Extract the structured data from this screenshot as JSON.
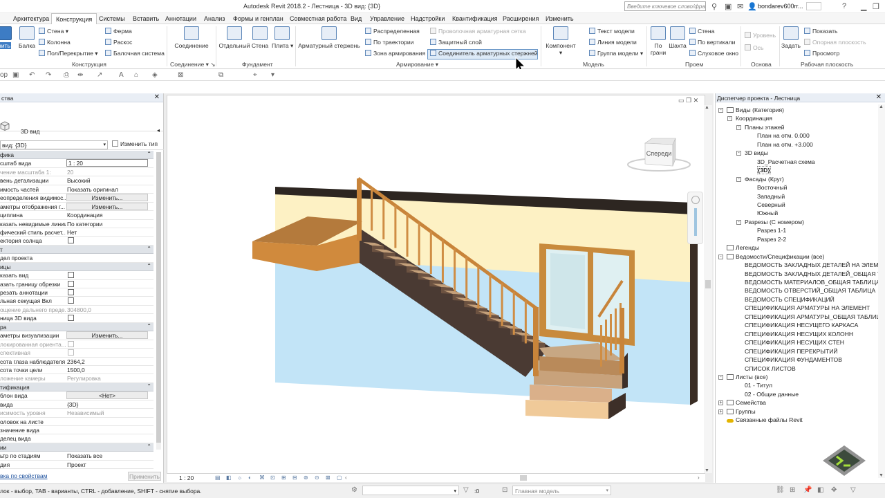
{
  "app": {
    "title": "Autodesk Revit 2018.2 -    Лестница - 3D вид: {3D}"
  },
  "titlebar": {
    "search_placeholder": "Введите ключевое слово/фразу",
    "user": "bondarev600rr..."
  },
  "menu": {
    "tabs": [
      {
        "label": "Архитектура",
        "active": false
      },
      {
        "label": "Конструкция",
        "active": true
      },
      {
        "label": "Системы",
        "active": false
      },
      {
        "label": "Вставить",
        "active": false
      },
      {
        "label": "Аннотации",
        "active": false
      },
      {
        "label": "Анализ",
        "active": false
      },
      {
        "label": "Формы и генплан",
        "active": false
      },
      {
        "label": "Совместная работа",
        "active": false
      },
      {
        "label": "Вид",
        "active": false
      },
      {
        "label": "Управление",
        "active": false
      },
      {
        "label": "Надстройки",
        "active": false
      },
      {
        "label": "Квантификация",
        "active": false
      },
      {
        "label": "Расширения",
        "active": false
      },
      {
        "label": "Изменить",
        "active": false
      }
    ]
  },
  "ribbon": {
    "structure": {
      "label": "Конструкция",
      "balka": "Балка",
      "stena": "Стена",
      "kolonna": "Колонна",
      "pol": "Пол/Перекрытие",
      "ferma": "Ферма",
      "raskos": "Раскос",
      "balochnaya": "Балочная система",
      "izmenit": "нить"
    },
    "connection": {
      "label": "Соединение",
      "btn": "Соединение"
    },
    "foundation": {
      "label": "Фундамент",
      "otdelny": "Отдельный",
      "stena": "Стена",
      "plita": "Плита"
    },
    "reinforcement": {
      "label": "Армирование",
      "armaturny": "Арматурный стержень",
      "raspredelennaya": "Распределенная",
      "po_traektorii": "По траектории",
      "zona": "Зона армирования",
      "provolochnaya": "Проволочная арматурная сетка",
      "zaschitny": "Защитный слой",
      "soedinitel": "Соединитель арматурных стержней"
    },
    "model": {
      "label": "Модель",
      "komponent": "Компонент",
      "tekst": "Текст модели",
      "liniya": "Линия модели",
      "gruppa": "Группа модели"
    },
    "opening": {
      "label": "Проем",
      "po_grani": "По грани",
      "shakhta": "Шахта",
      "stena": "Стена",
      "po_vertikali": "По вертикали",
      "slukhovoe": "Слуховое окно"
    },
    "datum": {
      "label": "Основа",
      "uroven": "Уровень",
      "os": "Ось"
    },
    "workplane": {
      "label": "Рабочая плоскость",
      "zadat": "Задать",
      "pokazat": "Показать",
      "opornaya": "Опорная плоскость",
      "prosmotr": "Просмотр"
    }
  },
  "quick_access": {
    "left_label": "ор"
  },
  "properties": {
    "title": "ства",
    "type_name": "3D вид",
    "selector": "вид: {3D}",
    "edit_type": "Изменить тип",
    "rows": [
      {
        "kind": "sec",
        "name": "фика"
      },
      {
        "kind": "input",
        "name": "сштаб вида",
        "value": "1 : 20"
      },
      {
        "kind": "text",
        "name": "чение масштаба   1:",
        "value": "20",
        "dim": true
      },
      {
        "kind": "text",
        "name": "вень детализации",
        "value": "Высокий"
      },
      {
        "kind": "text",
        "name": "имость частей",
        "value": "Показать оригинал"
      },
      {
        "kind": "btn",
        "name": "еопределения видимос...",
        "value": "Изменить..."
      },
      {
        "kind": "btn",
        "name": "аметры отображения г...",
        "value": "Изменить..."
      },
      {
        "kind": "text",
        "name": "циплина",
        "value": "Координация"
      },
      {
        "kind": "text",
        "name": "казать невидимые линии",
        "value": "По категории"
      },
      {
        "kind": "text",
        "name": "фический стиль расчет...",
        "value": "Нет"
      },
      {
        "kind": "chk",
        "name": "ектория солнца"
      },
      {
        "kind": "sec",
        "name": "т"
      },
      {
        "kind": "text",
        "name": "дел проекта",
        "value": ""
      },
      {
        "kind": "sec",
        "name": "ицы"
      },
      {
        "kind": "chk",
        "name": "казать вид"
      },
      {
        "kind": "chk",
        "name": "азать границу обрезки"
      },
      {
        "kind": "chk",
        "name": "резать аннотации"
      },
      {
        "kind": "chk",
        "name": "льная секущая Вкл"
      },
      {
        "kind": "text",
        "name": "ощение дальнего преде...",
        "value": "304800,0",
        "dim": true
      },
      {
        "kind": "chk",
        "name": "ница 3D вида"
      },
      {
        "kind": "sec",
        "name": "ра"
      },
      {
        "kind": "btn",
        "name": "аметры визуализации",
        "value": "Изменить..."
      },
      {
        "kind": "chkd",
        "name": "локированная ориента..."
      },
      {
        "kind": "chkd",
        "name": "спективная"
      },
      {
        "kind": "text",
        "name": "сота глаза наблюдателя",
        "value": "2364,2"
      },
      {
        "kind": "text",
        "name": "сота точки цели",
        "value": "1500,0"
      },
      {
        "kind": "text",
        "name": "ложение камеры",
        "value": "Регулировка",
        "dim": true
      },
      {
        "kind": "sec",
        "name": "тификация"
      },
      {
        "kind": "btn",
        "name": "блон вида",
        "value": "<Нет>"
      },
      {
        "kind": "text",
        "name": "вида",
        "value": "{3D}"
      },
      {
        "kind": "text",
        "name": "исимость уровня",
        "value": "Независимый",
        "dim": true
      },
      {
        "kind": "text",
        "name": "оловок на листе",
        "value": ""
      },
      {
        "kind": "text",
        "name": "значение вида",
        "value": ""
      },
      {
        "kind": "text",
        "name": "делец вида",
        "value": ""
      },
      {
        "kind": "sec",
        "name": "ии"
      },
      {
        "kind": "text",
        "name": "ьтр по стадиям",
        "value": "Показать все"
      },
      {
        "kind": "text",
        "name": "дия",
        "value": "Проект"
      }
    ],
    "help_link": "вка по свойствам",
    "apply": "Применить"
  },
  "viewport": {
    "scale": "1 : 20",
    "viewcube_label": "Спереди"
  },
  "browser": {
    "title": "Диспетчер проекта - Лестница",
    "items": [
      {
        "label": "Виды (Категория)",
        "level": 0,
        "tog": "-",
        "icon": "views"
      },
      {
        "label": "Координация",
        "level": 1,
        "tog": "-"
      },
      {
        "label": "Планы этажей",
        "level": 2,
        "tog": "-"
      },
      {
        "label": "План на отм. 0.000",
        "level": 3
      },
      {
        "label": "План на отм. +3.000",
        "level": 3
      },
      {
        "label": "3D виды",
        "level": 2,
        "tog": "-"
      },
      {
        "label": "3D_Расчетная схема",
        "level": 3
      },
      {
        "label": "{3D}",
        "level": 3,
        "bold": true
      },
      {
        "label": "Фасады (Круг)",
        "level": 2,
        "tog": "-"
      },
      {
        "label": "Восточный",
        "level": 3
      },
      {
        "label": "Западный",
        "level": 3
      },
      {
        "label": "Северный",
        "level": 3
      },
      {
        "label": "Южный",
        "level": 3
      },
      {
        "label": "Разрезы (С номером)",
        "level": 2,
        "tog": "-"
      },
      {
        "label": "Разрез 1-1",
        "level": 3
      },
      {
        "label": "Разрез 2-2",
        "level": 3
      },
      {
        "label": "Легенды",
        "level": 0,
        "icon": "grid"
      },
      {
        "label": "Ведомости/Спецификации (все)",
        "level": 0,
        "tog": "-",
        "icon": "grid"
      },
      {
        "label": "ВЕДОМОСТЬ ЗАКЛАДНЫХ ДЕТАЛЕЙ НА ЭЛЕМЕНТ",
        "level": 2
      },
      {
        "label": "ВЕДОМОСТЬ ЗАКЛАДНЫХ ДЕТАЛЕЙ_ОБЩАЯ ТАБЛИЦА",
        "level": 2
      },
      {
        "label": "ВЕДОМОСТЬ МАТЕРИАЛОВ_ОБЩАЯ ТАБЛИЦА",
        "level": 2
      },
      {
        "label": "ВЕДОМОСТЬ ОТВЕРСТИЙ_ОБЩАЯ ТАБЛИЦА",
        "level": 2
      },
      {
        "label": "ВЕДОМОСТЬ СПЕЦИФИКАЦИЙ",
        "level": 2
      },
      {
        "label": "СПЕЦИФИКАЦИЯ АРМАТУРЫ НА ЭЛЕМЕНТ",
        "level": 2
      },
      {
        "label": "СПЕЦИФИКАЦИЯ АРМАТУРЫ_ОБЩАЯ ТАБЛИЦА",
        "level": 2
      },
      {
        "label": "СПЕЦИФИКАЦИЯ НЕСУЩЕГО КАРКАСА",
        "level": 2
      },
      {
        "label": "СПЕЦИФИКАЦИЯ НЕСУЩИХ КОЛОНН",
        "level": 2
      },
      {
        "label": "СПЕЦИФИКАЦИЯ НЕСУЩИХ СТЕН",
        "level": 2
      },
      {
        "label": "СПЕЦИФИКАЦИЯ ПЕРЕКРЫТИЙ",
        "level": 2
      },
      {
        "label": "СПЕЦИФИКАЦИЯ ФУНДАМЕНТОВ",
        "level": 2
      },
      {
        "label": "СПИСОК ЛИСТОВ",
        "level": 2
      },
      {
        "label": "Листы (все)",
        "level": 0,
        "tog": "-",
        "icon": "sheet"
      },
      {
        "label": "01 - Титул",
        "level": 2
      },
      {
        "label": "02 - Общие данные",
        "level": 2
      },
      {
        "label": "Семейства",
        "level": 0,
        "tog": "+",
        "icon": "fam"
      },
      {
        "label": "Группы",
        "level": 0,
        "tog": "+",
        "icon": "grp"
      },
      {
        "label": "Связанные файлы Revit",
        "level": 0,
        "icon": "link"
      }
    ]
  },
  "status": {
    "text": "лок - выбор, TAB - варианты, CTRL - добавление, SHIFT - снятие выбора.",
    "zero": ":0",
    "model": "Главная модель"
  }
}
